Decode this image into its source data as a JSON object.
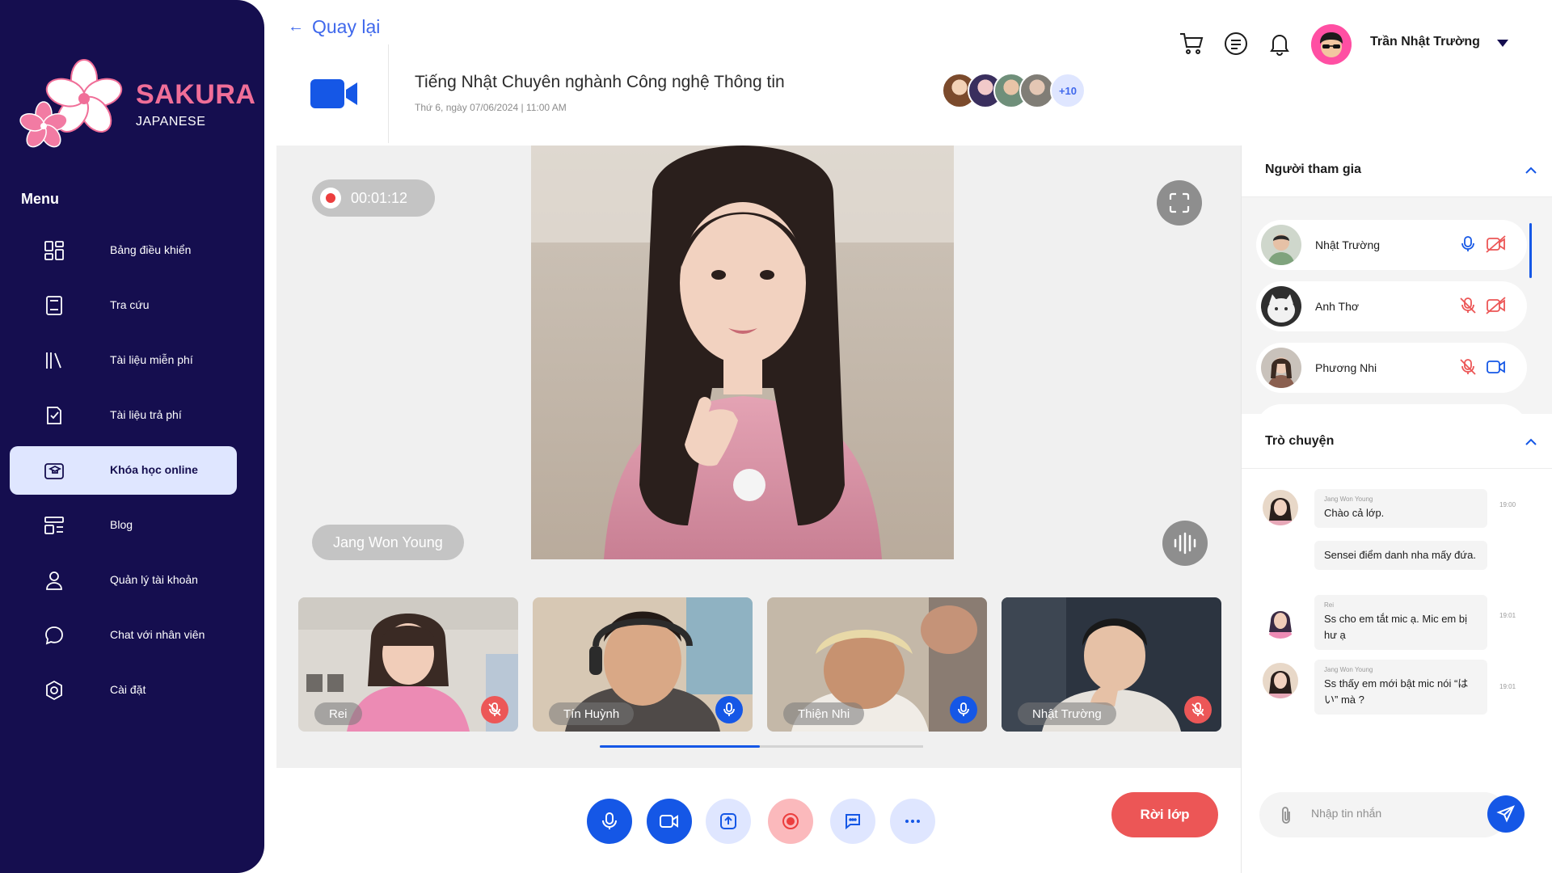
{
  "brand": {
    "name": "SAKURA",
    "sub": "JAPANESE"
  },
  "sidebar": {
    "menu_title": "Menu",
    "items": [
      {
        "label": "Bảng điều khiển",
        "icon": "dashboard-icon",
        "active": false
      },
      {
        "label": "Tra cứu",
        "icon": "book-icon",
        "active": false
      },
      {
        "label": "Tài liệu miễn phí",
        "icon": "library-icon",
        "active": false
      },
      {
        "label": "Tài liệu trả phí",
        "icon": "paid-doc-icon",
        "active": false
      },
      {
        "label": "Khóa học online",
        "icon": "online-course-icon",
        "active": true
      },
      {
        "label": "Blog",
        "icon": "blog-icon",
        "active": false
      },
      {
        "label": "Quản lý tài khoản",
        "icon": "user-icon",
        "active": false
      },
      {
        "label": "Chat với nhân viên",
        "icon": "chat-icon",
        "active": false
      },
      {
        "label": "Cài đặt",
        "icon": "settings-icon",
        "active": false
      }
    ]
  },
  "header": {
    "back_label": "Quay lại",
    "class_title": "Tiếng Nhật Chuyên nghành Công nghệ Thông tin",
    "class_date": "Thứ 6, ngày 07/06/2024 | 11:00 AM",
    "more_participants": "+10",
    "user_name": "Trần Nhật Trường"
  },
  "stage": {
    "record_time": "00:01:12",
    "speaker_name": "Jang Won Young",
    "thumbnails": [
      {
        "name": "Rei",
        "mic": "off"
      },
      {
        "name": "Tín Huỳnh",
        "mic": "on"
      },
      {
        "name": "Thiện Nhi",
        "mic": "on"
      },
      {
        "name": "Nhật Trường",
        "mic": "off"
      }
    ],
    "thumb_scroll_progress": 0.495
  },
  "controls": {
    "leave_label": "Rời lớp"
  },
  "participants": {
    "title": "Người tham gia",
    "list": [
      {
        "name": "Nhật Trường",
        "mic": "on",
        "cam": "off"
      },
      {
        "name": "Anh Thơ",
        "mic": "off",
        "cam": "off"
      },
      {
        "name": "Phương Nhi",
        "mic": "off",
        "cam": "on"
      }
    ]
  },
  "chat": {
    "title": "Trò chuyện",
    "messages": [
      {
        "sender": "Jang Won Young",
        "text": "Chào cả lớp.",
        "time": "19:00"
      },
      {
        "sender": "",
        "text": "Sensei điểm danh nha mấy đứa.",
        "time": ""
      },
      {
        "sender": "Rei",
        "text": "Ss cho em tắt mic ạ. Mic em bị hư ạ",
        "time": "19:01"
      },
      {
        "sender": "Jang Won Young",
        "text": "Ss thấy em mới bật mic nói “はい” mà ?",
        "time": "19:01"
      }
    ],
    "input_placeholder": "Nhập tin nhắn"
  },
  "colors": {
    "sidebar_bg": "#150e4f",
    "brand_pink": "#f06e98",
    "primary_blue": "#1557e6",
    "leave_red": "#ec5656",
    "active_menu_bg": "#dfe6ff"
  }
}
